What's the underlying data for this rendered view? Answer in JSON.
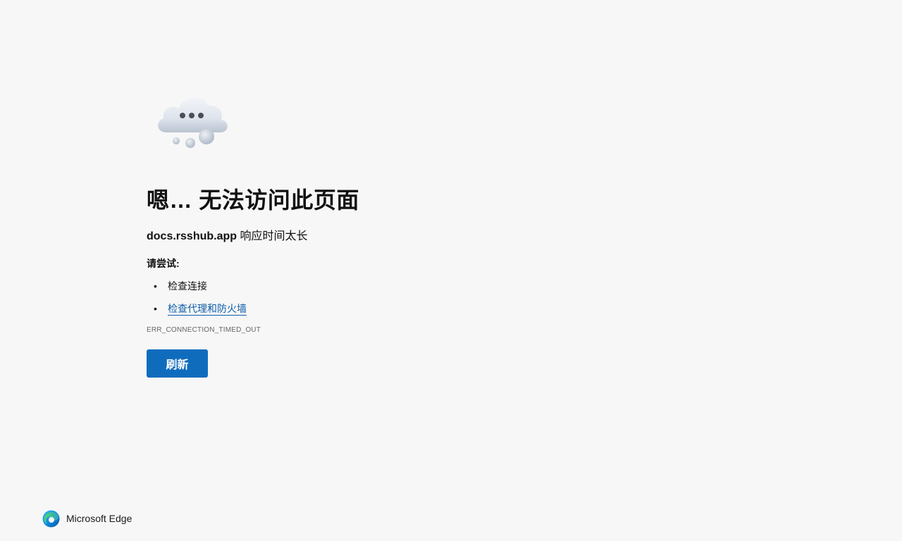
{
  "error_page": {
    "title": "嗯… 无法访问此页面",
    "host": "docs.rsshub.app",
    "message": " 响应时间太长",
    "try_label": "请尝试:",
    "suggestions": [
      {
        "text": "检查连接",
        "is_link": false
      },
      {
        "text": "检查代理和防火墙",
        "is_link": true
      }
    ],
    "error_code": "ERR_CONNECTION_TIMED_OUT",
    "refresh_label": "刷新"
  },
  "branding": {
    "name": "Microsoft Edge",
    "icon": "edge-logo-icon"
  },
  "illustration": {
    "icon": "cloud-thinking-icon"
  },
  "colors": {
    "background": "#f7f7f7",
    "button": "#0f6cbd",
    "link": "#0f5ea8"
  }
}
